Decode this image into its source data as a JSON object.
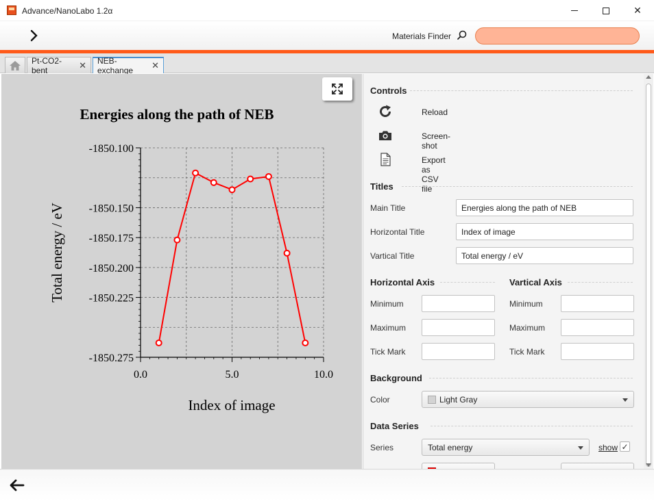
{
  "window": {
    "title": "Advance/NanoLabo 1.2α",
    "icon": "app-logo-icon",
    "controls": [
      "minimize-icon",
      "maximize-icon",
      "close-icon"
    ],
    "close_glyph": "✕"
  },
  "topbar": {
    "forward_icon": "chevron-right-icon",
    "finder_label": "Materials Finder",
    "finder_icon": "search-icon",
    "finder_value": "",
    "finder_placeholder": "",
    "accent_color": "#ff5a1a",
    "finder_bg": "#ffb496"
  },
  "tabs": [
    {
      "icon": "home-icon"
    },
    {
      "label": "Pt-CO2-bent",
      "close": "✕"
    },
    {
      "label": "NEB-exchange",
      "close": "✕",
      "active": true
    }
  ],
  "chart_panel": {
    "expand_icon": "expand-icon",
    "background": "#d3d3d3"
  },
  "chart_data": {
    "type": "line",
    "title": "Energies along the path of NEB",
    "xlabel": "Index of image",
    "ylabel": "Total energy / eV",
    "xlim": [
      0.0,
      10.0
    ],
    "ylim": [
      -1850.275,
      -1850.1
    ],
    "x_tick_labels": [
      "0.0",
      "5.0",
      "10.0"
    ],
    "y_tick_labels": [
      "-1850.100",
      "-1850.150",
      "-1850.175",
      "-1850.200",
      "-1850.225",
      "-1850.275"
    ],
    "grid": true,
    "series": [
      {
        "color": "#ff0000",
        "marker": "open-circle",
        "x": [
          1,
          2,
          3,
          4,
          5,
          6,
          7,
          8,
          9
        ],
        "y": [
          -1850.263,
          -1850.177,
          -1850.121,
          -1850.129,
          -1850.135,
          -1850.126,
          -1850.124,
          -1850.188,
          -1850.263
        ]
      }
    ]
  },
  "controls": {
    "heading": "Controls",
    "reload": {
      "label": "Reload",
      "icon": "reload-icon"
    },
    "screenshot": {
      "label": "Screen-shot",
      "icon": "camera-icon"
    },
    "export": {
      "label": "Export as CSV file",
      "icon": "document-icon"
    }
  },
  "titles": {
    "heading": "Titles",
    "main_label": "Main Title",
    "main_value": "Energies along the path of NEB",
    "horizontal_label": "Horizontal Title",
    "horizontal_value": "Index of image",
    "vertical_label": "Vartical Title",
    "vertical_value": "Total energy / eV"
  },
  "horizontal_axis": {
    "heading": "Horizontal Axis",
    "min_label": "Minimum",
    "min_value": "",
    "max_label": "Maximum",
    "max_value": "",
    "tick_label": "Tick Mark",
    "tick_value": ""
  },
  "vertical_axis": {
    "heading": "Vartical Axis",
    "min_label": "Minimum",
    "min_value": "",
    "max_label": "Maximum",
    "max_value": "",
    "tick_label": "Tick Mark",
    "tick_value": ""
  },
  "background": {
    "heading": "Background",
    "color_label": "Color",
    "color_value": "Light Gray",
    "swatch_color": "#d3d3d3"
  },
  "data_series": {
    "heading": "Data Series",
    "series_label": "Series",
    "series_value": "Total energy",
    "show_label": "show",
    "show_checked": "✓",
    "series_color": "#ff0000"
  },
  "bottombar": {
    "back_icon": "arrow-left-icon"
  }
}
